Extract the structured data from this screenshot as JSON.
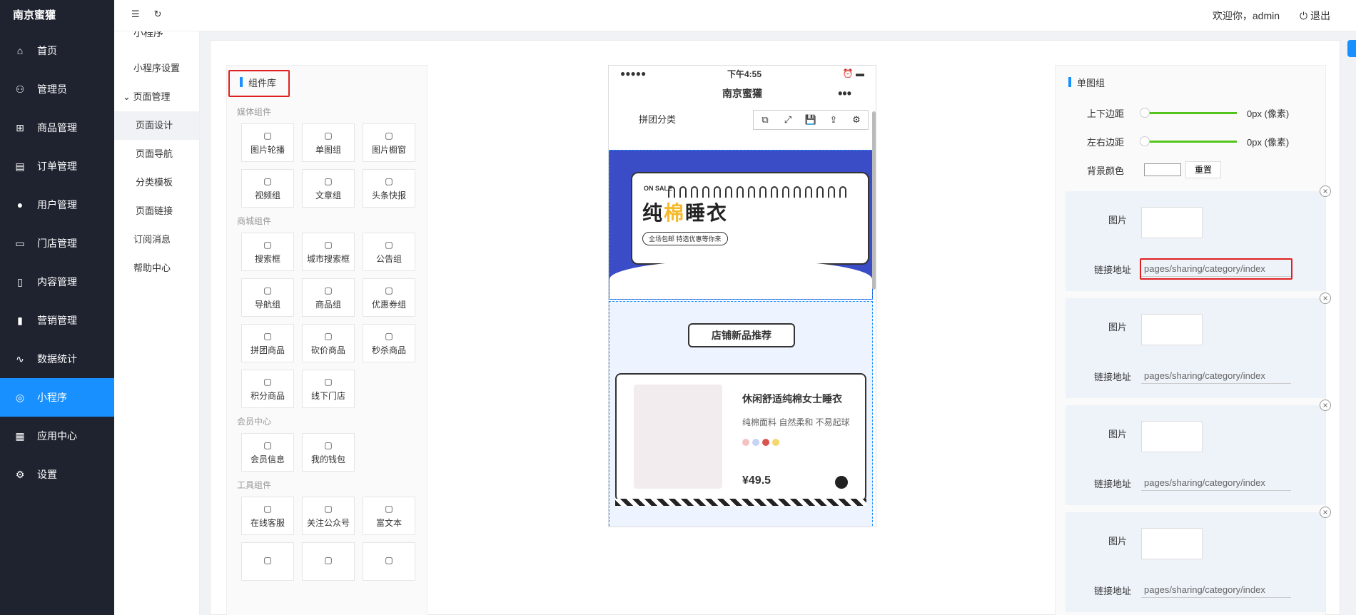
{
  "brand": "南京蜜獾",
  "nav": [
    {
      "label": "首页",
      "icon": "home-icon"
    },
    {
      "label": "管理员",
      "icon": "admin-icon"
    },
    {
      "label": "商品管理",
      "icon": "gift-icon"
    },
    {
      "label": "订单管理",
      "icon": "order-icon"
    },
    {
      "label": "用户管理",
      "icon": "user-icon"
    },
    {
      "label": "门店管理",
      "icon": "store-icon"
    },
    {
      "label": "内容管理",
      "icon": "document-icon"
    },
    {
      "label": "营销管理",
      "icon": "marketing-icon"
    },
    {
      "label": "数据统计",
      "icon": "chart-icon"
    },
    {
      "label": "小程序",
      "icon": "miniapp-icon"
    },
    {
      "label": "应用中心",
      "icon": "apps-icon"
    },
    {
      "label": "设置",
      "icon": "gear-icon"
    }
  ],
  "subnav": {
    "title": "小程序",
    "settings": "小程序设置",
    "group": "页面管理",
    "children": [
      "页面设计",
      "页面导航",
      "分类模板",
      "页面链接"
    ],
    "others": [
      "订阅消息",
      "帮助中心"
    ]
  },
  "topbar": {
    "welcome": "欢迎你，admin",
    "logout": "退出"
  },
  "library": {
    "title": "组件库",
    "categories": [
      {
        "name": "媒体组件",
        "items": [
          "图片轮播",
          "单图组",
          "图片橱窗",
          "视频组",
          "文章组",
          "头条快报"
        ]
      },
      {
        "name": "商城组件",
        "items": [
          "搜索框",
          "城市搜索框",
          "公告组",
          "导航组",
          "商品组",
          "优惠券组",
          "拼团商品",
          "砍价商品",
          "秒杀商品",
          "积分商品",
          "线下门店"
        ]
      },
      {
        "name": "会员中心",
        "items": [
          "会员信息",
          "我的钱包"
        ]
      },
      {
        "name": "工具组件",
        "items": [
          "在线客服",
          "关注公众号",
          "富文本",
          "",
          "",
          ""
        ]
      }
    ]
  },
  "phone": {
    "time": "下午4:55",
    "signal": "●●●●●",
    "title": "南京蜜獾",
    "more": "•••",
    "row": "拼团分类",
    "banner_small": "ON SALE",
    "banner_title_a": "纯",
    "banner_title_b": "棉",
    "banner_title_c": "睡衣",
    "banner_pill": "全场包邮 特选优惠等你来",
    "tag": "店铺新品推荐",
    "product_name": "休闲舒适纯棉女士睡衣",
    "product_desc": "纯棉面料 自然柔和 不易起球",
    "price": "¥49.5",
    "dot_colors": [
      "#f4c2c2",
      "#c7d3f5",
      "#d9534f",
      "#f5d76e"
    ]
  },
  "right": {
    "title": "单图组",
    "margin_v": "上下边距",
    "margin_h": "左右边距",
    "unit": "0px (像素)",
    "bg": "背景颜色",
    "reset": "重置",
    "img_label": "图片",
    "link_label": "链接地址",
    "link_value": "pages/sharing/category/index"
  }
}
